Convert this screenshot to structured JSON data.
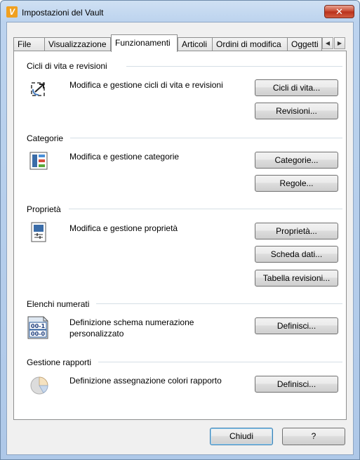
{
  "window": {
    "title": "Impostazioni del Vault",
    "app_icon_letter": "V",
    "close_symbol": "✕"
  },
  "tabs": [
    {
      "label": "File"
    },
    {
      "label": "Visualizzazione"
    },
    {
      "label": "Funzionamenti"
    },
    {
      "label": "Articoli"
    },
    {
      "label": "Ordini di modifica"
    },
    {
      "label": "Oggetti"
    }
  ],
  "active_tab": "Funzionamenti",
  "tab_scroll": {
    "left": "◀",
    "right": "▶"
  },
  "groups": {
    "lifecycles": {
      "title": "Cicli di vita e revisioni",
      "description": "Modifica e gestione cicli di vita e revisioni",
      "buttons": [
        "Cicli di vita...",
        "Revisioni..."
      ],
      "icon": "lifecycle-icon"
    },
    "categories": {
      "title": "Categorie",
      "description": "Modifica e gestione categorie",
      "buttons": [
        "Categorie...",
        "Regole..."
      ],
      "icon": "categories-icon"
    },
    "properties": {
      "title": "Proprietà",
      "description": "Modifica e gestione proprietà",
      "buttons": [
        "Proprietà...",
        "Scheda dati...",
        "Tabella revisioni..."
      ],
      "icon": "properties-icon"
    },
    "numbering": {
      "title": "Elenchi numerati",
      "description": "Definizione schema numerazione personalizzato",
      "buttons": [
        "Definisci..."
      ],
      "icon": "numbering-icon",
      "icon_text": [
        "00-1",
        "00-0"
      ]
    },
    "reports": {
      "title": "Gestione rapporti",
      "description": "Definizione assegnazione colori rapporto",
      "buttons": [
        "Definisci..."
      ],
      "icon": "pie-chart-icon"
    }
  },
  "footer": {
    "close_label": "Chiudi",
    "help_label": "?"
  },
  "colors": {
    "title_bar": "#bcd3ee",
    "close_button": "#c6442c",
    "default_button_border": "#3c7fb1"
  }
}
